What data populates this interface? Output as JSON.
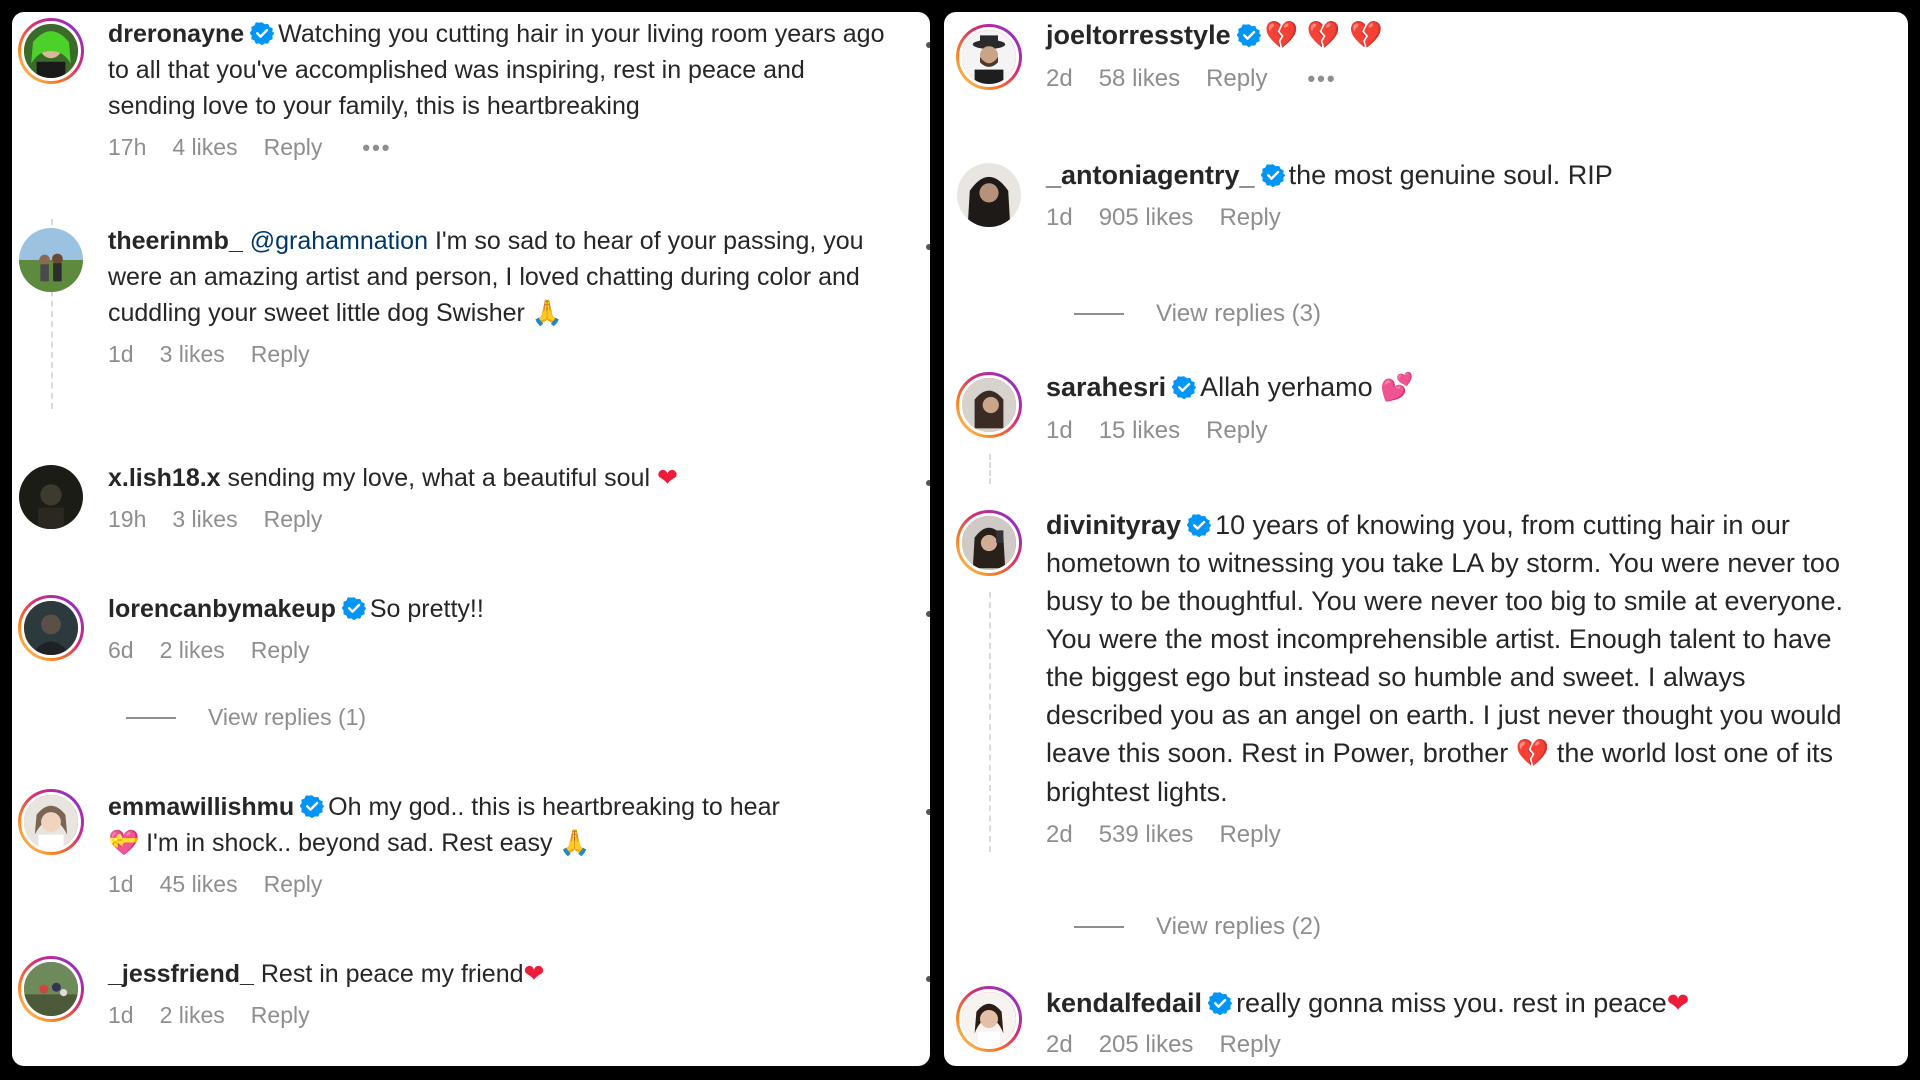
{
  "left_comments": [
    {
      "username": "dreronayne",
      "verified": true,
      "mention": "",
      "text": "Watching you cutting hair in your living room years ago to all that you've accomplished was inspiring, rest in peace and sending love to your family, this is heartbreaking",
      "emoji": "",
      "age": "17h",
      "likes": "4 likes",
      "reply": "Reply",
      "more": "•••"
    },
    {
      "username": "theerinmb_",
      "verified": false,
      "mention": "@grahamnation",
      "text": "I'm so sad to hear of your passing, you were an amazing artist and person, I loved chatting during color and cuddling your sweet little dog Swisher",
      "emoji": "🙏",
      "age": "1d",
      "likes": "3 likes",
      "reply": "Reply"
    },
    {
      "username": "x.lish18.x",
      "verified": false,
      "mention": "",
      "text": "sending my love, what a beautiful soul",
      "emoji": "❤",
      "age": "19h",
      "likes": "3 likes",
      "reply": "Reply"
    },
    {
      "username": "lorencanbymakeup",
      "verified": true,
      "mention": "",
      "text": "So pretty!!",
      "emoji": "",
      "age": "6d",
      "likes": "2 likes",
      "reply": "Reply"
    },
    {
      "username": "emmawillishmu",
      "verified": true,
      "mention": "",
      "text": "Oh my god.. this is heartbreaking to hear",
      "text2": "I'm in shock.. beyond sad. Rest easy",
      "emoji_mid": "💝",
      "emoji": "🙏",
      "age": "1d",
      "likes": "45 likes",
      "reply": "Reply"
    },
    {
      "username": "_jessfriend_",
      "verified": false,
      "mention": "",
      "text": "Rest in peace my friend",
      "emoji": "❤",
      "age": "1d",
      "likes": "2 likes",
      "reply": "Reply"
    }
  ],
  "left_view_replies": "View replies (1)",
  "right_comments": [
    {
      "username": "joeltorresstyle",
      "verified": true,
      "text": "",
      "emoji": "💔 💔 💔",
      "age": "2d",
      "likes": "58 likes",
      "reply": "Reply",
      "more": "•••"
    },
    {
      "username": "_antoniagentry_",
      "verified": true,
      "text": "the most genuine soul. RIP",
      "emoji": "",
      "age": "1d",
      "likes": "905 likes",
      "reply": "Reply"
    },
    {
      "username": "sarahesri",
      "verified": true,
      "text": "Allah yerhamo",
      "emoji": "💕",
      "age": "1d",
      "likes": "15 likes",
      "reply": "Reply"
    },
    {
      "username": "divinityray",
      "verified": true,
      "text": "10 years of knowing you, from cutting hair in our hometown to witnessing you take LA by storm. You were never too busy to be thoughtful. You were never too big to smile at everyone. You were the most incomprehensible artist. Enough talent to have the biggest ego but instead so humble and sweet. I always described you as an angel on earth. I just never thought you would leave this soon. Rest in Power, brother",
      "emoji": "💔",
      "text2": "the world lost one of its brightest lights.",
      "age": "2d",
      "likes": "539 likes",
      "reply": "Reply"
    },
    {
      "username": "kendalfedail",
      "verified": true,
      "text": "really gonna miss you. rest in peace",
      "emoji": "❤",
      "age": "2d",
      "likes": "205 likes",
      "reply": "Reply"
    }
  ],
  "right_view_replies_1": "View replies (3)",
  "right_view_replies_2": "View replies (2)",
  "colors": {
    "verified": "#0095f6",
    "meta": "#8e8e8e",
    "mention": "#00376b",
    "heart": "#ed1c3b"
  }
}
